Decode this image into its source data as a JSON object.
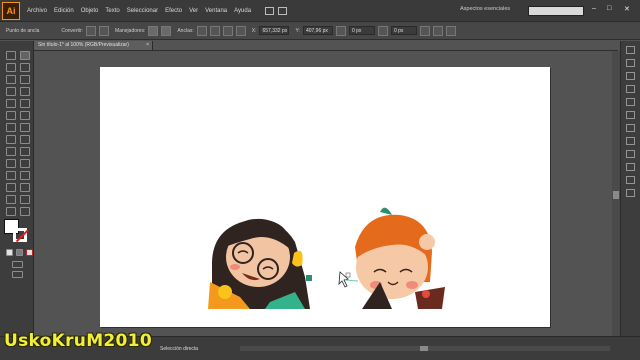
{
  "app": {
    "logo": "Ai",
    "menu": [
      "Archivo",
      "Edición",
      "Objeto",
      "Texto",
      "Seleccionar",
      "Efecto",
      "Ver",
      "Ventana",
      "Ayuda"
    ],
    "workspace": "Aspectos esenciales",
    "window_controls": [
      "–",
      "□",
      "✕"
    ]
  },
  "control_bar": {
    "left_label": "Punto de ancla",
    "convert_label": "Convertir:",
    "handles_label": "Manejadores:",
    "anchors_label": "Anclas:",
    "x_label": "X:",
    "x_value": "657,332 px",
    "y_label": "Y:",
    "y_value": "407,96 px",
    "w_value": "0 px",
    "h_value": "0 px"
  },
  "document": {
    "tab_title": "Sin título-1* al 100% (RGB/Previsualizar)",
    "tab_close": "×"
  },
  "status": {
    "tool_name": "Selección directa"
  },
  "watermark": "UskoKruM2010",
  "colors": {
    "ui_dark": "#535353",
    "artboard": "#ffffff",
    "accent": "#f7941d",
    "watermark": "#f3ee3a"
  }
}
